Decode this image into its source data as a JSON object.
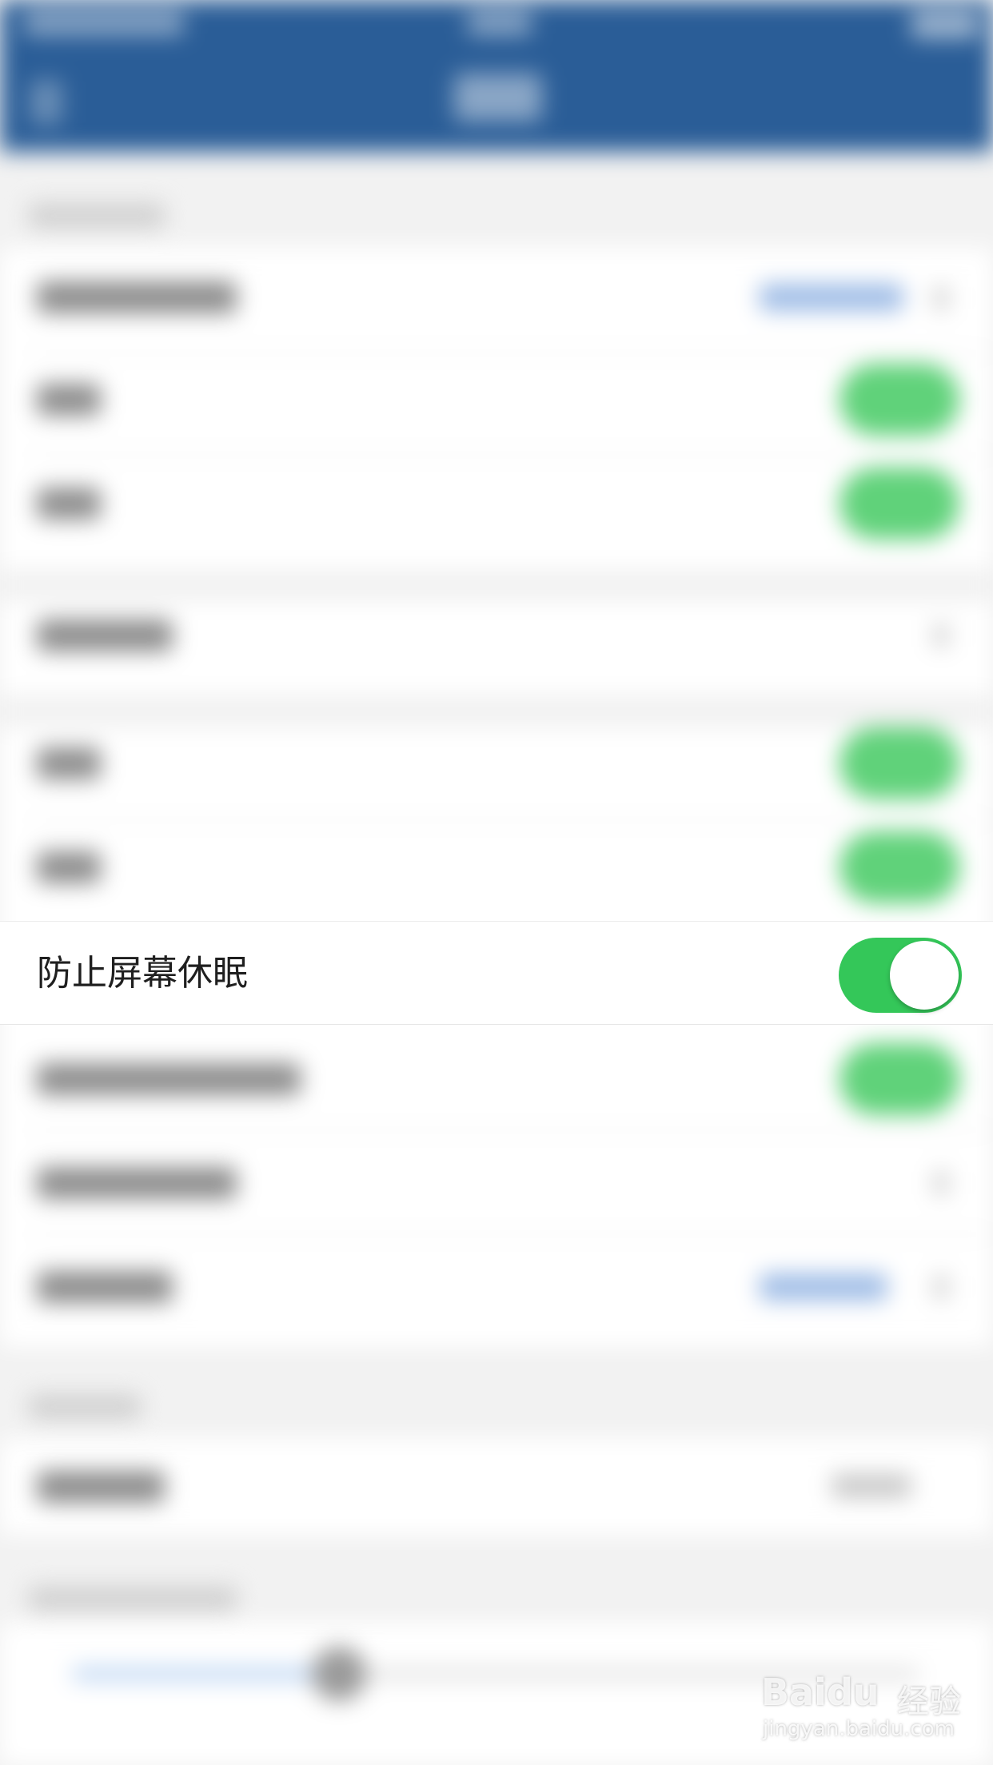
{
  "settings": {
    "prevent_sleep": {
      "label": "防止屏幕休眠",
      "enabled": true
    }
  },
  "colors": {
    "navbar": "#2a5d97",
    "toggle_on": "#34c759",
    "background": "#f2f2f2"
  },
  "watermark": {
    "logo": "Baidu",
    "brand": "经验",
    "url": "jingyan.baidu.com"
  }
}
